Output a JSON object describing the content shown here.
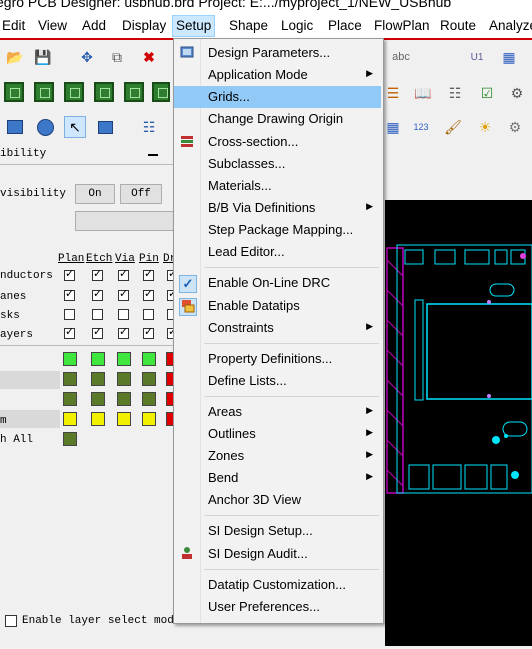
{
  "window_title": "egro PCB Designer: usbhub.brd  Project: E:.../myproject_1/NEW_USBhub",
  "menubar": [
    "Edit",
    "View",
    "Add",
    "Display",
    "Setup",
    "Shape",
    "Logic",
    "Place",
    "FlowPlan",
    "Route",
    "Analyze"
  ],
  "left_panel": {
    "header_partial": "ibility",
    "visibility_label": "visibility",
    "on_label": "On",
    "off_label": "Off",
    "columns": [
      "Plan",
      "Etch",
      "Via",
      "Pin",
      "Dr"
    ],
    "rows": [
      {
        "label": "nductors"
      },
      {
        "label": "anes"
      },
      {
        "label": "sks"
      },
      {
        "label": "ayers"
      }
    ],
    "color_rows": [
      {
        "label": ""
      },
      {
        "label": ""
      },
      {
        "label": ""
      },
      {
        "label": "m"
      },
      {
        "label": "h All"
      }
    ],
    "layer_select_label": "Enable layer select mode"
  },
  "setup_menu": [
    {
      "label": "Design Parameters...",
      "icon": "design-params-icon"
    },
    {
      "label": "Application Mode",
      "submenu": true
    },
    {
      "label": "Grids...",
      "highlighted": true
    },
    {
      "label": "Change Drawing Origin"
    },
    {
      "label": "Cross-section...",
      "icon": "cross-section-icon"
    },
    {
      "label": "Subclasses..."
    },
    {
      "label": "Materials..."
    },
    {
      "label": "B/B Via Definitions",
      "submenu": true
    },
    {
      "label": "Step Package Mapping..."
    },
    {
      "label": "Lead Editor..."
    },
    {
      "label": "Enable On-Line DRC",
      "icon": "checkmark-icon",
      "sep_before": true
    },
    {
      "label": "Enable Datatips",
      "icon": "datatips-icon"
    },
    {
      "label": "Constraints",
      "submenu": true
    },
    {
      "label": "Property Definitions...",
      "sep_before": true
    },
    {
      "label": "Define Lists..."
    },
    {
      "label": "Areas",
      "submenu": true,
      "sep_before": true
    },
    {
      "label": "Outlines",
      "submenu": true
    },
    {
      "label": "Zones",
      "submenu": true
    },
    {
      "label": "Bend",
      "submenu": true
    },
    {
      "label": "Anchor 3D View"
    },
    {
      "label": "SI Design Setup...",
      "sep_before": true
    },
    {
      "label": "SI Design Audit...",
      "icon": "si-audit-icon"
    },
    {
      "label": "Datatip Customization...",
      "sep_before": true
    },
    {
      "label": "User Preferences..."
    }
  ],
  "colors": {
    "accent": "#cce8ff",
    "highlight": "#91c9f7",
    "canvas": "#000000",
    "pcb_outline": "#00e5ff",
    "pcb_magenta": "#c000c0"
  }
}
